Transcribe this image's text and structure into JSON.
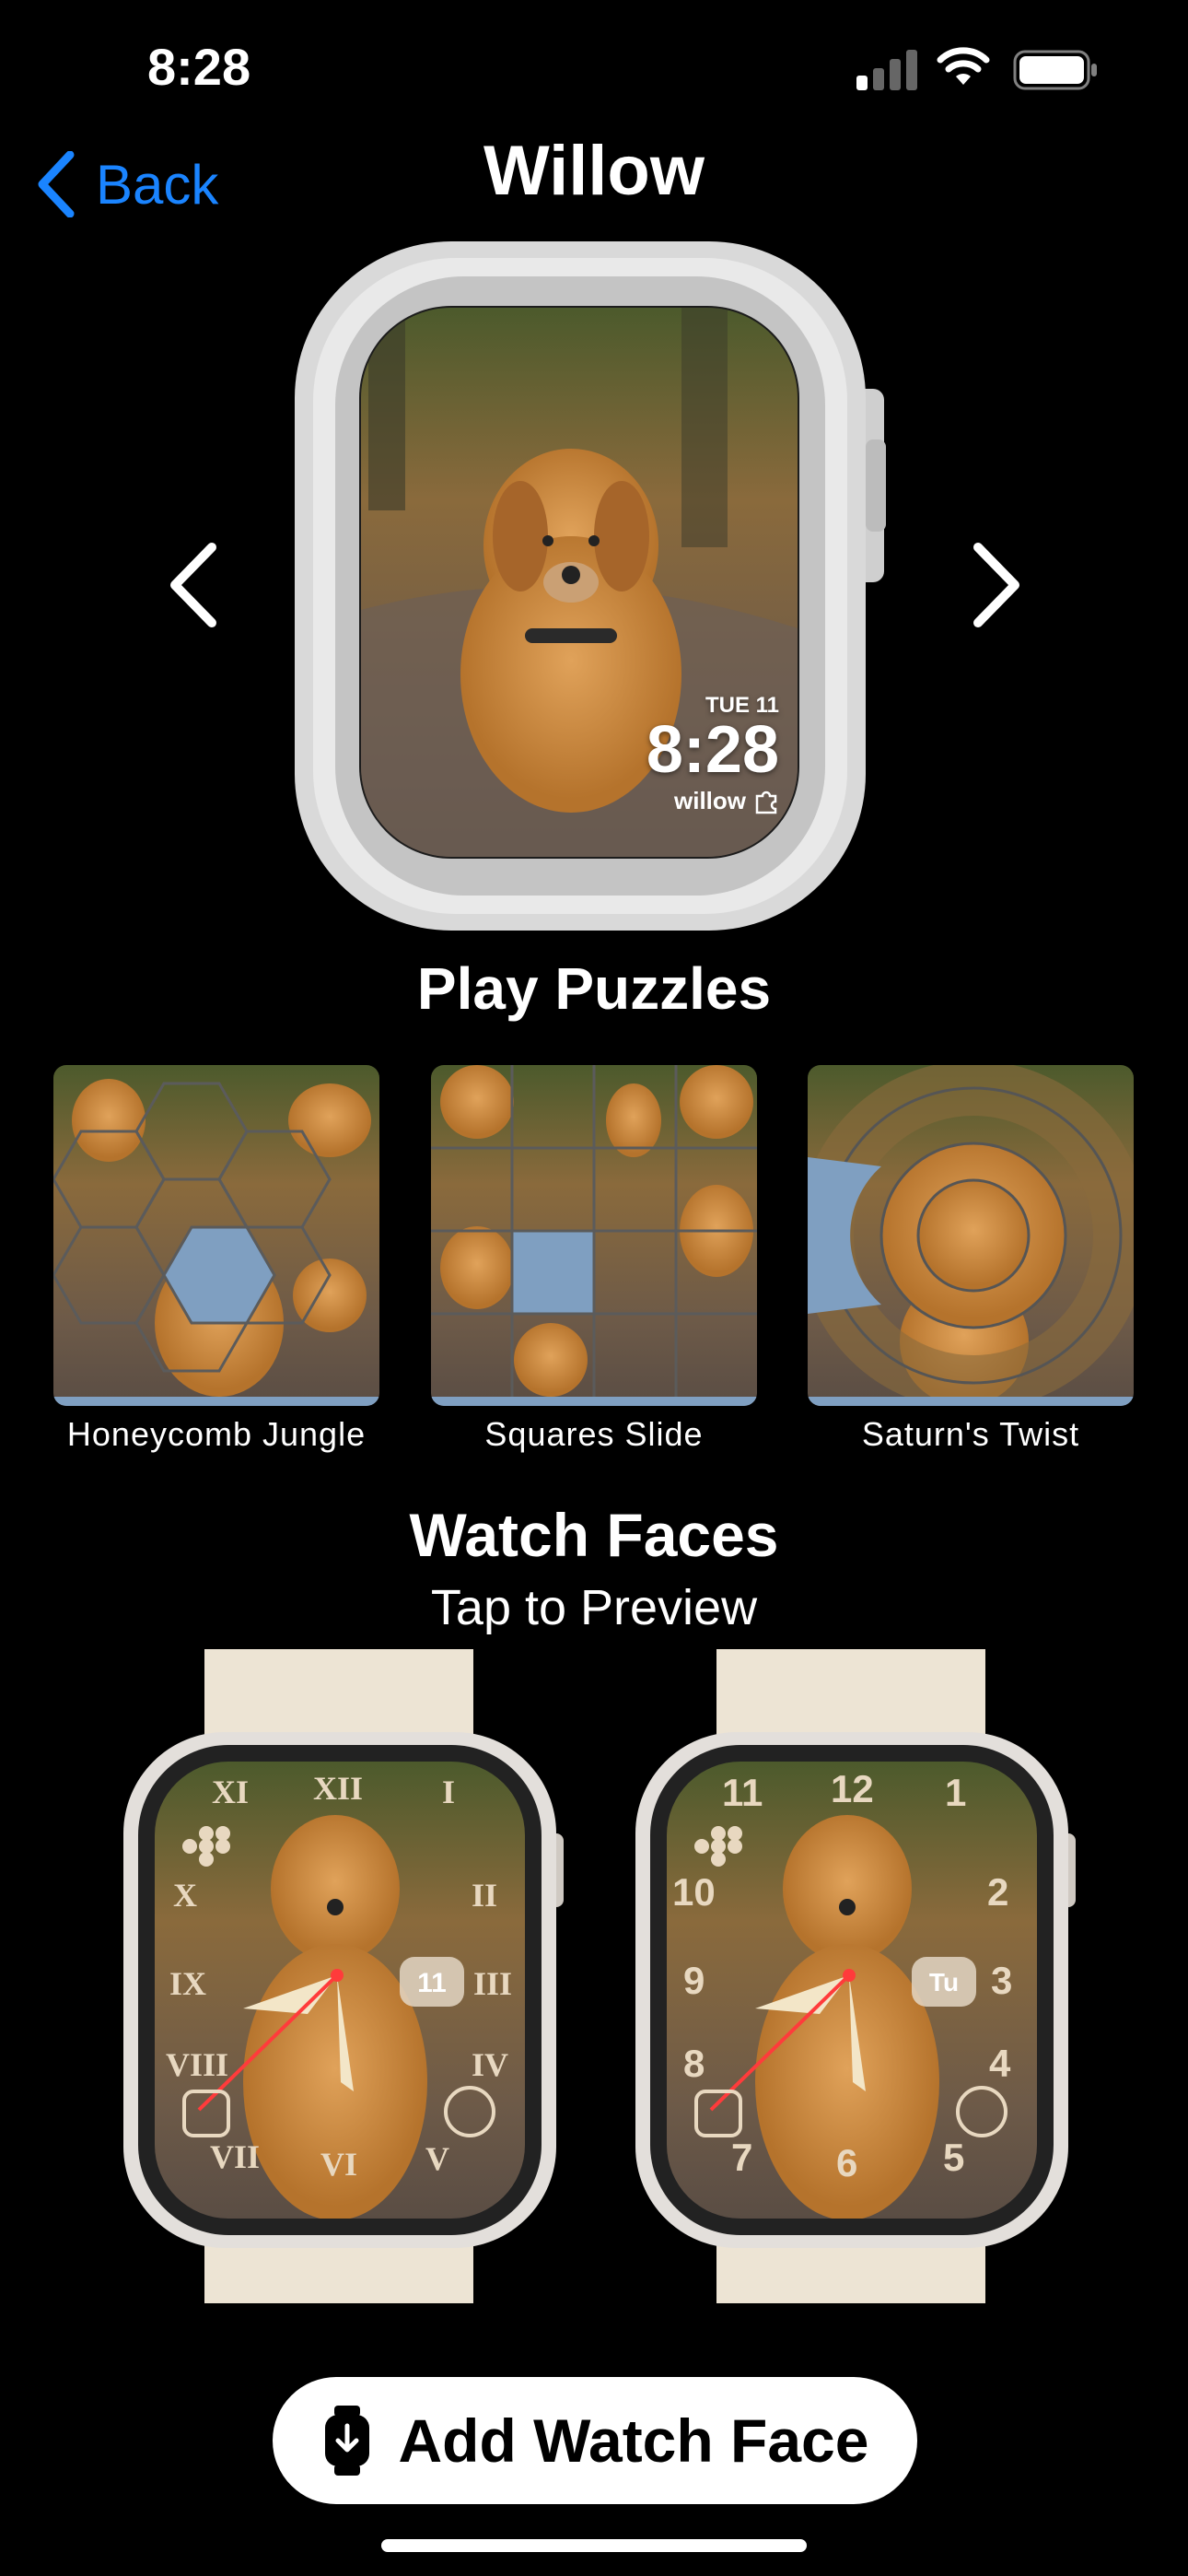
{
  "status_bar": {
    "time": "8:28"
  },
  "nav": {
    "back_label": "Back",
    "title": "Willow"
  },
  "preview": {
    "date": "TUE 11",
    "time": "8:28",
    "name": "willow"
  },
  "puzzles": {
    "heading": "Play Puzzles",
    "items": [
      {
        "label": "Honeycomb Jungle"
      },
      {
        "label": "Squares Slide"
      },
      {
        "label": "Saturn's Twist"
      }
    ]
  },
  "watch_faces": {
    "heading": "Watch Faces",
    "subheading": "Tap to Preview",
    "faces": [
      {
        "numerals": [
          "XII",
          "I",
          "II",
          "III",
          "IV",
          "V",
          "VI",
          "VII",
          "VIII",
          "IX",
          "X",
          "XI"
        ],
        "complication": "11"
      },
      {
        "numerals": [
          "12",
          "1",
          "2",
          "3",
          "4",
          "5",
          "6",
          "7",
          "8",
          "9",
          "10",
          "11"
        ],
        "complication": "Tu"
      }
    ]
  },
  "action": {
    "label": "Add Watch Face"
  },
  "colors": {
    "accent": "#1a84ff",
    "empty_tile": "#7f9fc1",
    "band": "#ede4d4",
    "case": "#e3dfdb"
  }
}
